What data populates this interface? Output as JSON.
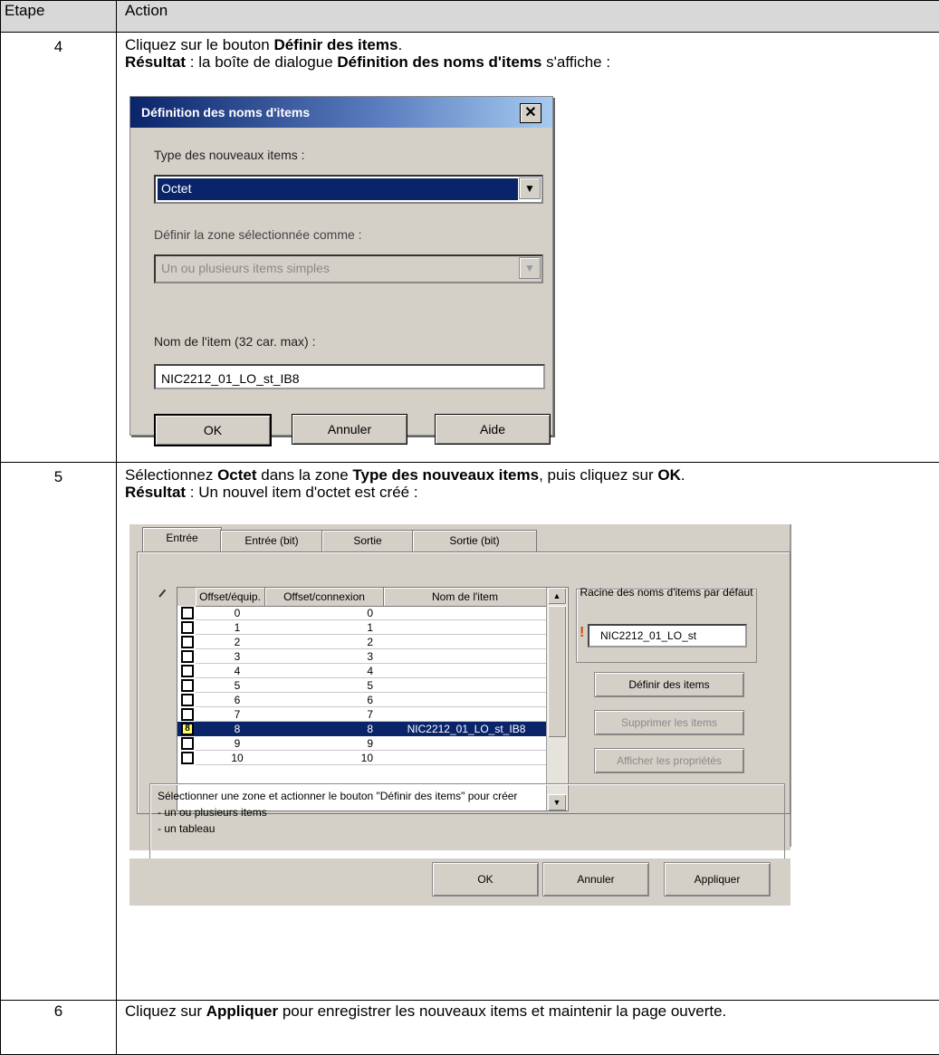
{
  "header": {
    "col1": "Etape",
    "col2": "Action"
  },
  "step4": {
    "num": "4",
    "line1_pre": "Cliquez sur le bouton ",
    "line1_bold": "Définir des items",
    "line1_post": ".",
    "line2_bold1": "Résultat",
    "line2_mid": " : la boîte de dialogue ",
    "line2_bold2": "Définition des noms d'items",
    "line2_post": " s'affiche :",
    "dialog": {
      "title": "Définition des noms d'items",
      "close": "✕",
      "type_label": "Type des nouveaux items :",
      "type_value": "Octet",
      "zone_label": "Définir la zone sélectionnée comme :",
      "zone_value": "Un ou plusieurs items simples",
      "name_label": "Nom de l'item (32 car. max) :",
      "name_value": "NIC2212_01_LO_st_IB8",
      "ok": "OK",
      "cancel": "Annuler",
      "help": "Aide"
    }
  },
  "step5": {
    "num": "5",
    "line1_pre": "Sélectionnez ",
    "line1_bold1": "Octet",
    "line1_mid": " dans la zone ",
    "line1_bold2": "Type des nouveaux items",
    "line1_mid2": ", puis cliquez sur ",
    "line1_bold3": "OK",
    "line1_post": ".",
    "line2_bold": "Résultat",
    "line2_post": " : Un nouvel item d'octet est créé :",
    "panel": {
      "tabs": [
        "Entrée",
        "Entrée (bit)",
        "Sortie",
        "Sortie (bit)"
      ],
      "columns": [
        "Offset/équip.",
        "Offset/connexion",
        "Nom de l'item"
      ],
      "rows": [
        {
          "a": "0",
          "b": "0",
          "name": ""
        },
        {
          "a": "1",
          "b": "1",
          "name": ""
        },
        {
          "a": "2",
          "b": "2",
          "name": ""
        },
        {
          "a": "3",
          "b": "3",
          "name": ""
        },
        {
          "a": "4",
          "b": "4",
          "name": ""
        },
        {
          "a": "5",
          "b": "5",
          "name": ""
        },
        {
          "a": "6",
          "b": "6",
          "name": ""
        },
        {
          "a": "7",
          "b": "7",
          "name": ""
        },
        {
          "a": "8",
          "b": "8",
          "name": "NIC2212_01_LO_st_IB8",
          "mark": "8"
        },
        {
          "a": "9",
          "b": "9",
          "name": ""
        },
        {
          "a": "10",
          "b": "10",
          "name": ""
        }
      ],
      "root_label": "Racine des noms d'items par défaut",
      "root_value": "NIC2212_01_LO_st",
      "btn_define": "Définir des items",
      "btn_delete": "Supprimer les items",
      "btn_props": "Afficher les propriétés",
      "help_lines": [
        "Sélectionner une zone et actionner le bouton \"Définir des items\" pour créer",
        "- un ou plusieurs items",
        "- un tableau"
      ],
      "ok": "OK",
      "cancel": "Annuler",
      "apply": "Appliquer"
    }
  },
  "step6": {
    "num": "6",
    "pre": "Cliquez sur ",
    "bold": "Appliquer",
    "post": " pour enregistrer les nouveaux items et maintenir la page ouverte."
  }
}
